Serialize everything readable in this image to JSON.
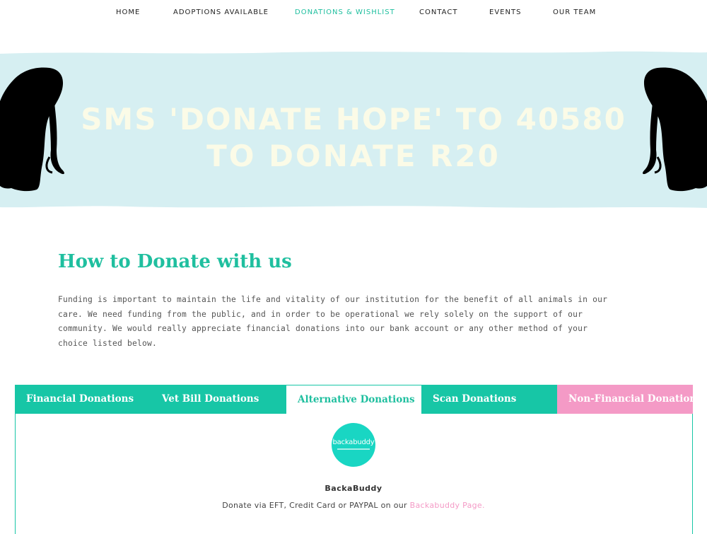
{
  "nav": {
    "items": [
      {
        "label": "HOME"
      },
      {
        "label": "ADOPTIONS AVAILABLE"
      },
      {
        "label": "DONATIONS & WISHLIST"
      },
      {
        "label": "CONTACT"
      },
      {
        "label": "EVENTS"
      },
      {
        "label": "OUR TEAM"
      }
    ],
    "active": "DONATIONS & WISHLIST"
  },
  "banner": {
    "line1": "SMS 'DONATE HOPE' TO 40580",
    "line2": "TO DONATE R20",
    "background_color": "#d6eff2",
    "text_color": "#fbfbe7",
    "icons": [
      "dog-with-leash-silhouette-left",
      "dog-with-leash-silhouette-right"
    ]
  },
  "main": {
    "title": "How to Donate with us",
    "intro": "Funding is important to maintain the life and vitality of our institution for the benefit of all animals in our care. We need funding from the public, and in order to be operational we rely solely on the support of our community. We would really appreciate financial donations into our bank account or any other method of your choice listed below."
  },
  "tabs": [
    {
      "label": "Financial Donations",
      "color": "#17c6a6"
    },
    {
      "label": "Vet Bill Donations",
      "color": "#17c6a6"
    },
    {
      "label": "Alternative Donations",
      "color": "#ffffff",
      "active": true
    },
    {
      "label": "Scan Donations",
      "color": "#17c6a6"
    },
    {
      "label": "Non-Financial Donation",
      "color": "#f49ac6"
    }
  ],
  "panel": {
    "logo_text": "backabuddy",
    "name": "BackaBuddy",
    "desc_prefix": "Donate via EFT, Credit Card or PAYPAL on our ",
    "link_text": "Backabuddy Page."
  },
  "colors": {
    "accent": "#1fbf9f",
    "teal": "#17c6a6",
    "pink": "#f49ac6"
  }
}
